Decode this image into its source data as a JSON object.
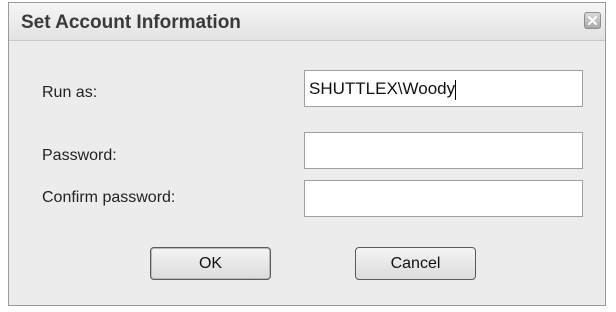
{
  "dialog": {
    "title": "Set Account Information"
  },
  "form": {
    "run_as_label": "Run as:",
    "run_as_value": "SHUTTLEX\\Woody",
    "password_label": "Password:",
    "password_value": "",
    "confirm_label": "Confirm password:",
    "confirm_value": ""
  },
  "buttons": {
    "ok_label": "OK",
    "cancel_label": "Cancel"
  },
  "icons": {
    "close": "close-icon"
  }
}
